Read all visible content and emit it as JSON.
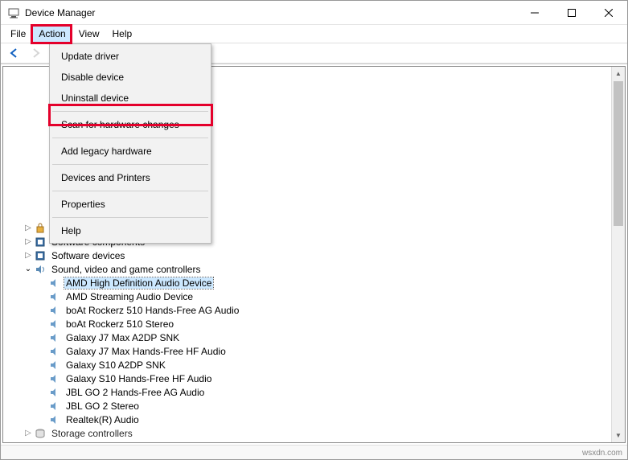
{
  "window": {
    "title": "Device Manager"
  },
  "menubar": {
    "file": "File",
    "action": "Action",
    "view": "View",
    "help": "Help"
  },
  "dropdown": {
    "update_driver": "Update driver",
    "disable_device": "Disable device",
    "uninstall_device": "Uninstall device",
    "scan": "Scan for hardware changes",
    "add_legacy": "Add legacy hardware",
    "devices_printers": "Devices and Printers",
    "properties": "Properties",
    "help": "Help"
  },
  "tree": {
    "visible_top_categories": [
      "Security devices",
      "Software components",
      "Software devices"
    ],
    "expanded_category": "Sound, video and game controllers",
    "sound_children": [
      "AMD High Definition Audio Device",
      "AMD Streaming Audio Device",
      "boAt Rockerz 510 Hands-Free AG Audio",
      "boAt Rockerz 510 Stereo",
      "Galaxy J7 Max A2DP SNK",
      "Galaxy J7 Max Hands-Free HF Audio",
      "Galaxy S10 A2DP SNK",
      "Galaxy S10 Hands-Free HF Audio",
      "JBL GO 2 Hands-Free AG Audio",
      "JBL GO 2 Stereo",
      "Realtek(R) Audio"
    ],
    "selected_child_index": 0,
    "bottom_category": "Storage controllers"
  },
  "watermark": "wsxdn.com"
}
